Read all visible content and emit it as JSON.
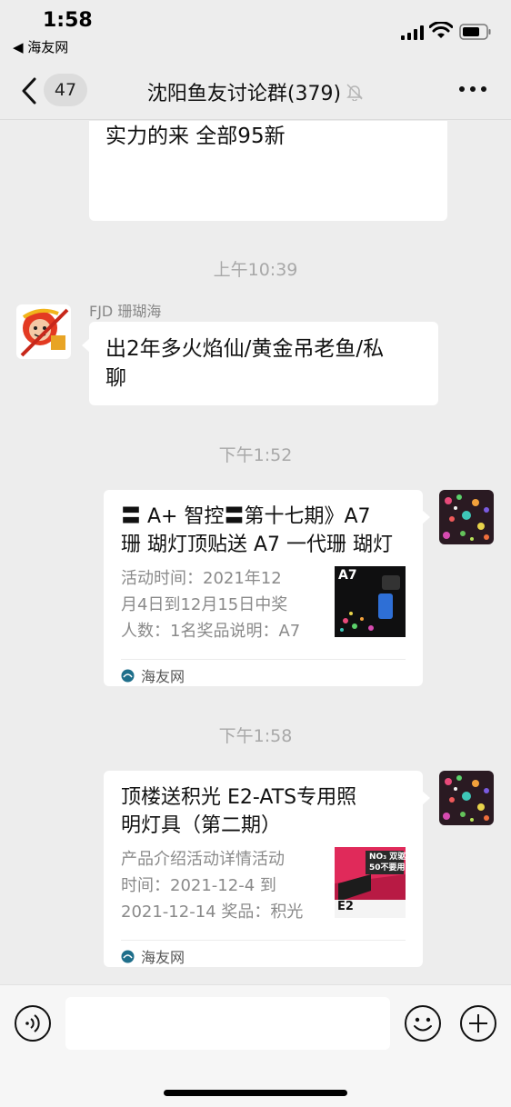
{
  "status_bar": {
    "time": "1:58",
    "back_app": "◀ 海友网"
  },
  "nav": {
    "unread_count": "47",
    "title": "沈阳鱼友讨论群(379)"
  },
  "messages": {
    "msg1": {
      "text": "实力的来 全部95新"
    },
    "ts1": "上午10:39",
    "msg2": {
      "sender": "FJD 珊瑚海",
      "line1": "出2年多火焰仙/黄金吊老鱼/私",
      "line2": "聊"
    },
    "ts2": "下午1:52",
    "card1": {
      "title_line1": "〓 A+ 智控〓第十七期》A7",
      "title_line2": "珊 瑚灯顶贴送 A7 一代珊 瑚灯",
      "desc_line1": "活动时间：2021年12",
      "desc_line2": "月4日到12月15日中奖",
      "desc_line3": "人数：1名奖品说明：A7",
      "thumb_text": "A7",
      "source": "海友网"
    },
    "ts3": "下午1:58",
    "card2": {
      "title_line1": "顶楼送积光 E2-ATS专用照",
      "title_line2": "明灯具（第二期）",
      "desc_line1": "产品介绍活动详情活动",
      "desc_line2": "时间：2021-12-4 到",
      "desc_line3": "2021-12-14 奖品：积光",
      "thumb_text_line1": "NO₃ 双驱",
      "thumb_text_line2": "50不要用",
      "thumb_text_line3": "E2",
      "source": "海友网"
    }
  },
  "input": {
    "placeholder": ""
  },
  "colors": {
    "background": "#ededed",
    "bubble": "#ffffff",
    "timestamp": "#a8a8a8",
    "source_icon": "#1f6f8b"
  }
}
